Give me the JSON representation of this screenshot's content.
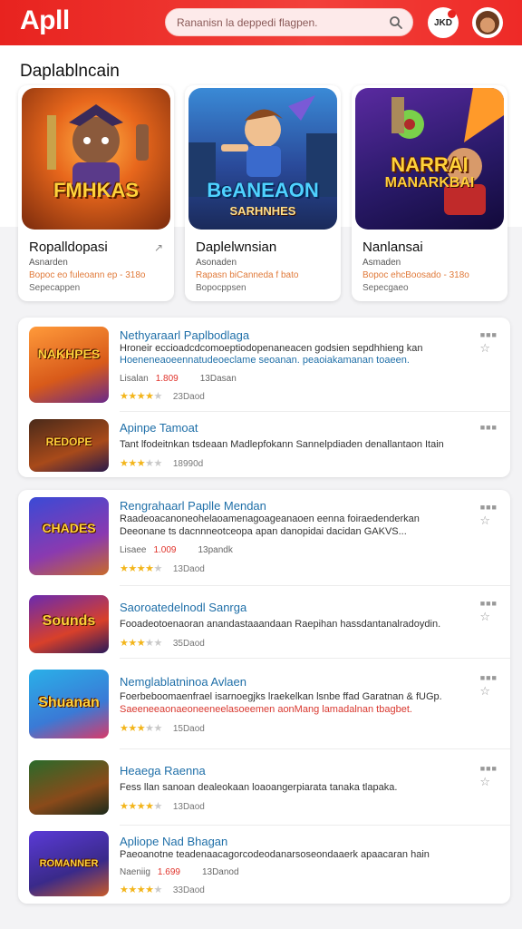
{
  "app": {
    "logo": "Apll"
  },
  "search": {
    "placeholder": "Rananisn la deppedi flagpen."
  },
  "header": {
    "notification_label": "JKD"
  },
  "section": {
    "title": "Daplablncain"
  },
  "featured": [
    {
      "art_title": "FMHKAS",
      "art_sub": "",
      "name": "Ropalldopasi",
      "share": "↗",
      "line1": "Asnarden",
      "line2": "Bopoc eo fuleoann ep - 318o",
      "line3": "Sepecappen"
    },
    {
      "art_title": "BeANEAON",
      "art_sub": "SARHNHES",
      "name": "Daplelwnsian",
      "share": "",
      "line1": "Asonaden",
      "line2": "Rapasn biCanneda f bato",
      "line3": "Bopocppsen"
    },
    {
      "art_title": "NARRAI",
      "art_sub": "MANARKBAI",
      "name": "Nanlansai",
      "share": "",
      "line1": "Asmaden",
      "line2": "Bopoc ehcBoosado - 318o",
      "line3": "Sepecgaeo"
    }
  ],
  "list_group_1": [
    {
      "thumb_title": "NAKHPES",
      "title": "Nethyaraarl Paplbodlaga",
      "desc": "Hroneir eccioadcdcomoeptiodopenaneacen godsien sepdhhieng kan",
      "desc2": "Hoeneneaoeennatudeoeclame seoanan. peaoiakamanan toaeen.",
      "desc2_color": "blue",
      "meta_label": "Lisalan",
      "meta_red": "1.809",
      "meta_count": "13Dasan",
      "rating": 4,
      "rating_count": "23Daod"
    },
    {
      "thumb_title": "REDOPE",
      "title": "Apinpe Tamoat",
      "desc": "Tant lfodeitnkan tsdeaan Madlepfokann Sannelpdiaden denallantaon Itain",
      "desc2": "",
      "desc2_color": "blue",
      "meta_label": "",
      "meta_red": "",
      "meta_count": "",
      "rating": 3,
      "rating_count": "18990d"
    }
  ],
  "list_group_2": [
    {
      "thumb_title": "CHADES",
      "title": "Rengrahaarl Paplle Mendan",
      "desc": "Raadeoacanoneohelaoamenagoageanaoen eenna foiraedenderkan",
      "desc2": "Deeonane ts dacnnneotceopa apan danopidai dacidan GAKVS...",
      "desc2_color": "dark",
      "meta_label": "Lisaee",
      "meta_red": "1.009",
      "meta_count": "13pandk",
      "rating": 4,
      "rating_count": "13Daod"
    },
    {
      "thumb_title": "Sounds",
      "title": "Saoroatedelnodl Sanrga",
      "desc": "Fooadeotoenaoran anandastaaandaan Raepihan hassdantanalradoydin.",
      "desc2": "",
      "desc2_color": "blue",
      "meta_label": "",
      "meta_red": "",
      "meta_count": "",
      "rating": 3,
      "rating_count": "35Daod"
    },
    {
      "thumb_title": "Shuanan",
      "title": "Nemglablatninoa Avlaen",
      "desc": "Foerbeboomaenfrael isarnoegjks lraekelkan lsnbe ffad Garatnan & fUGp.",
      "desc2": "Saeeneeaonaeoneeneelasoeemen aonMang lamadalnan tbagbet.",
      "desc2_color": "red",
      "meta_label": "",
      "meta_red": "",
      "meta_count": "",
      "rating": 3,
      "rating_count": "15Daod"
    },
    {
      "thumb_title": "",
      "title": "Heaega Raenna",
      "desc": "Fess llan sanoan dealeokaan loaoangerpiarata tanaka tlapaka.",
      "desc2": "",
      "desc2_color": "blue",
      "meta_label": "",
      "meta_red": "",
      "meta_count": "",
      "rating": 4,
      "rating_count": "13Daod"
    },
    {
      "thumb_title": "ROMANNER",
      "title": "Apliope Nad Bhagan",
      "desc": "Paeoanotne teadenaacagorcodeodanarsoseondaaerk apaacaran hain",
      "desc2": "",
      "desc2_color": "blue",
      "meta_label": "Naeniig",
      "meta_red": "1.699",
      "meta_count": "13Danod",
      "rating": 4,
      "rating_count": "33Daod"
    }
  ],
  "colors": {
    "brand": "#e8231f",
    "link": "#1f6fa8",
    "star": "#f3b51b"
  },
  "icons": {
    "search": "search-icon",
    "favorite": "star-outline-icon",
    "more": "more-dots-icon",
    "share": "share-arrow-icon"
  }
}
